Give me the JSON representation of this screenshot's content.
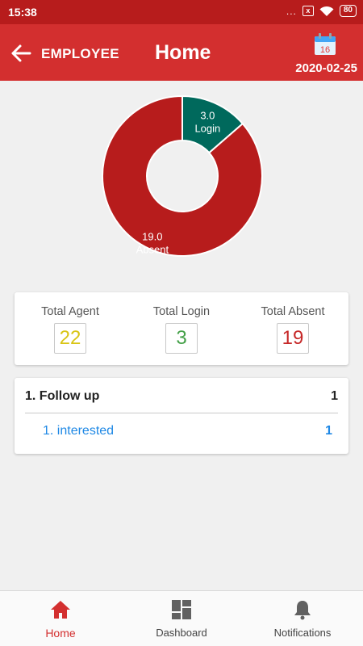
{
  "status_bar": {
    "time": "15:38",
    "dots": "...",
    "sim": "x",
    "battery": "80"
  },
  "app_bar": {
    "section": "EMPLOYEE",
    "title": "Home",
    "calendar_day": "16",
    "date": "2020-02-25"
  },
  "chart_data": {
    "type": "pie",
    "variant": "donut",
    "slices": [
      {
        "label": "Login",
        "value": 3.0,
        "value_text": "3.0",
        "color": "#00695c"
      },
      {
        "label": "Absent",
        "value": 19.0,
        "value_text": "19.0",
        "color": "#b71c1c"
      }
    ]
  },
  "stats": [
    {
      "label": "Total Agent",
      "value": "22",
      "color": "#d8c414"
    },
    {
      "label": "Total Login",
      "value": "3",
      "color": "#43a047"
    },
    {
      "label": "Total Absent",
      "value": "19",
      "color": "#c62828"
    }
  ],
  "followup": {
    "title": "1. Follow up",
    "count": "1",
    "items": [
      {
        "label": "1. interested",
        "count": "1"
      }
    ]
  },
  "nav": [
    {
      "label": "Home",
      "icon": "home-icon",
      "active": true
    },
    {
      "label": "Dashboard",
      "icon": "dashboard-icon",
      "active": false
    },
    {
      "label": "Notifications",
      "icon": "bell-icon",
      "active": false
    }
  ],
  "colors": {
    "primary": "#d32f2f",
    "primary_dark": "#b71c1c",
    "link": "#1e88e5"
  }
}
